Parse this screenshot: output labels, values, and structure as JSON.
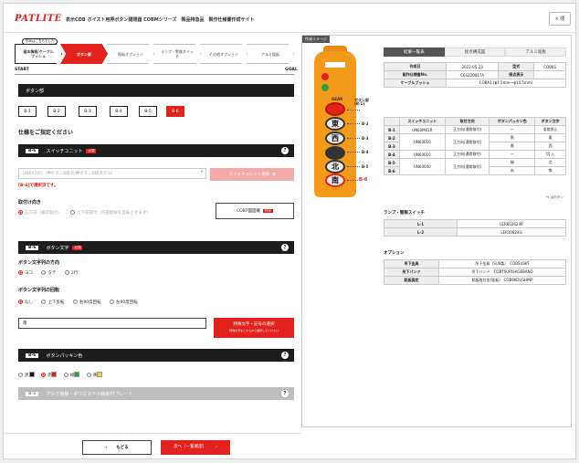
{
  "header": {
    "logo": "PATLITE",
    "title": "表示COB ホイスト用押ボタン開閉器 COBMシリーズ　製品特急品　製作仕様書作成サイト",
    "close_label": "× 閉"
  },
  "steps": {
    "badge": "形状はこちらでした",
    "items": [
      {
        "label": "基本情報/ケーブルブッシュ"
      },
      {
        "label": "ボタン部"
      },
      {
        "label": "銘板オプション"
      },
      {
        "label": "ランプ・警報スイッチ"
      },
      {
        "label": "その他オプション"
      },
      {
        "label": "アルミ銘板"
      }
    ],
    "start": "START",
    "goal": "GOAL"
  },
  "button_section": {
    "title": "ボタン部",
    "buttons": [
      "B-1",
      "B-2",
      "B-3",
      "B-4",
      "B-5",
      "B-6"
    ],
    "active_index": 5,
    "prompt": "仕様をご指定ください"
  },
  "switch_unit": {
    "tag": "B-6",
    "title": "スイッチユニット",
    "required": "必須",
    "help": "?",
    "select_value": "UN6024D（押ボタンB接点/押ボタンB接点タ2a",
    "select_button": "スイッチユニット選択",
    "note": "[B-6]で選択済です。",
    "mount_label": "取付け向き",
    "mount_options": [
      "正方向（通常取付）",
      "上下逆取付（内部配線を反転させます）"
    ],
    "drawing_button": "COB7図面確",
    "pdf": "PDF"
  },
  "button_text": {
    "tag": "B-6",
    "title": "ボタン文字",
    "required": "必須",
    "help": "?",
    "direction_label": "ボタン文字列の方向",
    "direction_options": [
      "ヨコ",
      "タテ",
      "2行"
    ],
    "direction_selected": 0,
    "rotation_label": "ボタン文字列の回転",
    "rotation_options": [
      "なし",
      "上下反転",
      "右90度回転",
      "左90度回転"
    ],
    "rotation_selected": 0,
    "text_value": "南",
    "special_button": "特殊文字・記号の選択",
    "special_sub": "特殊文字をこちらから選択してください"
  },
  "packing_color": {
    "tag": "B-6",
    "title": "ボタンパッキン色",
    "help": "?",
    "options": [
      {
        "label": "黒",
        "color": "#111111"
      },
      {
        "label": "赤",
        "color": "#e3211d"
      },
      {
        "label": "緑",
        "color": "#2e9e44"
      },
      {
        "label": "黄",
        "color": "#f2d21b"
      }
    ],
    "selected": 1
  },
  "aluminum_plate": {
    "tag": "B-6",
    "title": "アルミ銘板・ポリエステル銘板付プレート",
    "help": "?"
  },
  "footer": {
    "back_label": "もどる",
    "next_label": "次へ（一覧確認）"
  },
  "preview": {
    "tag": "作成イメージ",
    "kanji": [
      "東",
      "西",
      "北",
      "南"
    ],
    "callouts": [
      "ボタン部(B-1)",
      "B-2",
      "B-3",
      "B-4",
      "B-5",
      "B-6"
    ],
    "gear_label": "GEAR",
    "tabs": [
      "結果一覧表",
      "接点構成図",
      "アルミ銘板"
    ],
    "active_tab": 0,
    "info_rows": [
      [
        "作成日",
        "2022-05-23",
        "型式",
        "COB6S"
      ],
      [
        "製作仕様書No.",
        "C6S220047A",
        "接点表示",
        ""
      ],
      [
        "ケーブルブッシュ",
        "COBA1 (ϕ7.5mm〜ϕ10.5mm)",
        "",
        ""
      ]
    ],
    "switch_headers": [
      "",
      "スイッチユニット",
      "取付方向",
      "ボタンパッキン色",
      "ボタン文字"
    ],
    "switch_rows": [
      [
        "B-1",
        "UN60M01R",
        "正方向(通常取付)",
        "ー",
        "非常停止"
      ],
      [
        "B-2",
        "UN60010",
        "正方向(通常取付)",
        "黒",
        "東"
      ],
      [
        "B-3",
        "",
        "",
        "黒",
        "西"
      ],
      [
        "B-4",
        "UN60010",
        "正方向(通常取付)",
        "ー",
        "切 入"
      ],
      [
        "B-5",
        "UN60040",
        "正方向(通常取付)",
        "緑",
        "北"
      ],
      [
        "B-6",
        "",
        "",
        "赤",
        "南"
      ]
    ],
    "note": "*L はボタン",
    "lamp_title": "ランプ・警報スイッチ",
    "lamp_rows": [
      [
        "L-1",
        "LER602624R"
      ],
      [
        "L-2",
        "LER10824G"
      ]
    ],
    "option_title": "オプション",
    "option_rows": [
      [
        "吊下金具",
        "吊下金具（SUS製）　COBSUSKT"
      ],
      [
        "吊下バンド",
        "吊下バンド　COBTSURISAGEBAND"
      ],
      [
        "銘板固定",
        "銘板取付金(銘板)　COB6KOUSHINP"
      ]
    ]
  }
}
